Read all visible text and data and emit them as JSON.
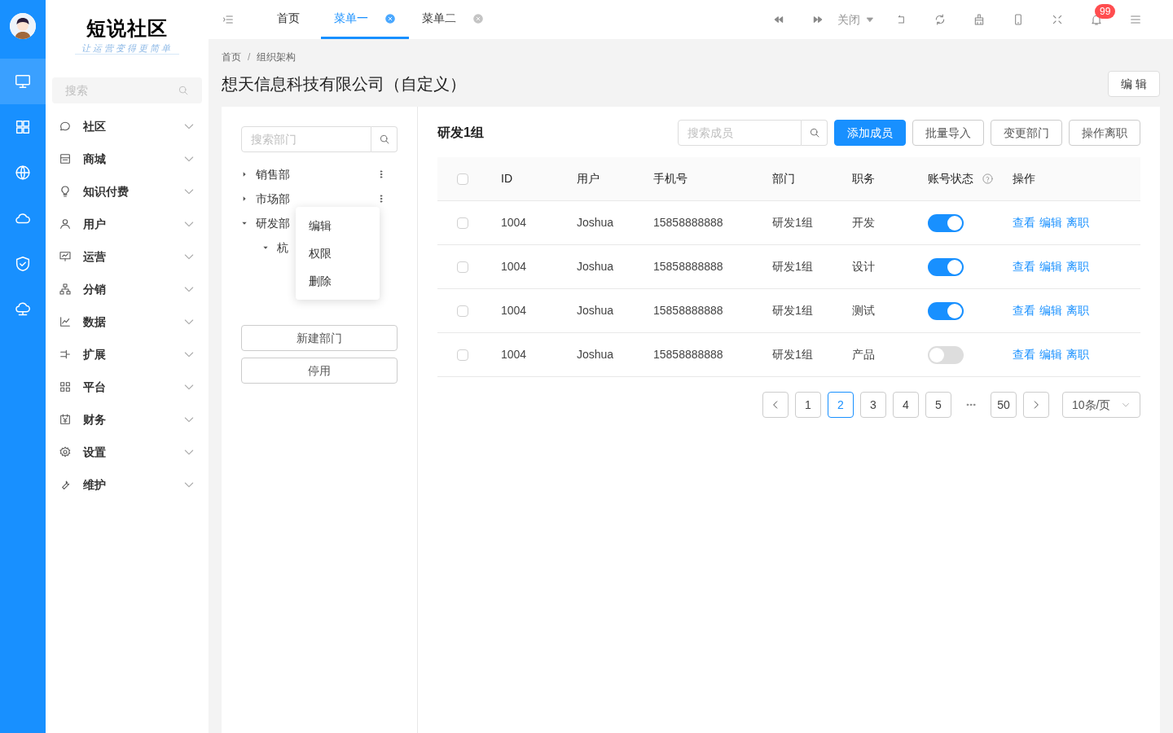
{
  "rail": {
    "items": [
      {
        "selected": true
      },
      {
        "selected": false
      },
      {
        "selected": false
      },
      {
        "selected": false
      },
      {
        "selected": false
      },
      {
        "selected": false
      }
    ]
  },
  "sidebar": {
    "logo": {
      "title": "短说社区",
      "tagline": "让运营变得更简单"
    },
    "search": {
      "placeholder": "搜索"
    },
    "items": [
      {
        "label": "社区"
      },
      {
        "label": "商城"
      },
      {
        "label": "知识付费"
      },
      {
        "label": "用户"
      },
      {
        "label": "运营"
      },
      {
        "label": "分销"
      },
      {
        "label": "数据"
      },
      {
        "label": "扩展"
      },
      {
        "label": "平台"
      },
      {
        "label": "财务"
      },
      {
        "label": "设置"
      },
      {
        "label": "维护"
      }
    ]
  },
  "topbar": {
    "tabs": [
      {
        "label": "首页",
        "selected": false,
        "closable": false
      },
      {
        "label": "菜单一",
        "selected": true,
        "closable": true
      },
      {
        "label": "菜单二",
        "selected": false,
        "closable": true
      }
    ],
    "close_menu": "关闭",
    "notification_count": "99"
  },
  "page": {
    "breadcrumb": {
      "items": [
        "首页",
        "组织架构"
      ],
      "separator": "/"
    },
    "title": "想天信息科技有限公司（自定义）",
    "edit_button": "编 辑"
  },
  "dept_panel": {
    "search": {
      "placeholder": "搜索部门"
    },
    "tree": [
      {
        "label": "销售部",
        "expanded": false,
        "more": true
      },
      {
        "label": "市场部",
        "expanded": false,
        "more": true
      },
      {
        "label": "研发部",
        "expanded": true,
        "more": false,
        "children": [
          {
            "label": "杭",
            "expanded": true,
            "more": false
          }
        ]
      }
    ],
    "context_menu": [
      "编辑",
      "权限",
      "删除"
    ],
    "buttons": [
      "新建部门",
      "停用"
    ]
  },
  "members": {
    "title": "研发1组",
    "search": {
      "placeholder": "搜索成员"
    },
    "buttons": [
      {
        "label": "添加成员",
        "primary": true
      },
      {
        "label": "批量导入",
        "primary": false
      },
      {
        "label": "变更部门",
        "primary": false
      },
      {
        "label": "操作离职",
        "primary": false
      }
    ],
    "table": {
      "select_all": false,
      "columns": [
        "ID",
        "用户",
        "手机号",
        "部门",
        "职务",
        "账号状态",
        "操作"
      ],
      "rows": [
        {
          "checked": false,
          "cells": [
            "1004",
            "Joshua",
            "15858888888",
            "研发1组",
            "开发"
          ],
          "enabled": true,
          "actions": [
            "查看",
            "编辑",
            "离职"
          ]
        },
        {
          "checked": false,
          "cells": [
            "1004",
            "Joshua",
            "15858888888",
            "研发1组",
            "设计"
          ],
          "enabled": true,
          "actions": [
            "查看",
            "编辑",
            "离职"
          ]
        },
        {
          "checked": false,
          "cells": [
            "1004",
            "Joshua",
            "15858888888",
            "研发1组",
            "测试"
          ],
          "enabled": true,
          "actions": [
            "查看",
            "编辑",
            "离职"
          ]
        },
        {
          "checked": false,
          "cells": [
            "1004",
            "Joshua",
            "15858888888",
            "研发1组",
            "产品"
          ],
          "enabled": false,
          "actions": [
            "查看",
            "编辑",
            "离职"
          ]
        }
      ]
    },
    "pagination": {
      "pages": [
        {
          "label": "1",
          "selected": false
        },
        {
          "label": "2",
          "selected": true
        },
        {
          "label": "3",
          "selected": false
        },
        {
          "label": "4",
          "selected": false
        },
        {
          "label": "5",
          "selected": false
        },
        {
          "kind": "ellipsis"
        },
        {
          "label": "50",
          "selected": false
        }
      ],
      "page_size": "10条/页"
    }
  }
}
